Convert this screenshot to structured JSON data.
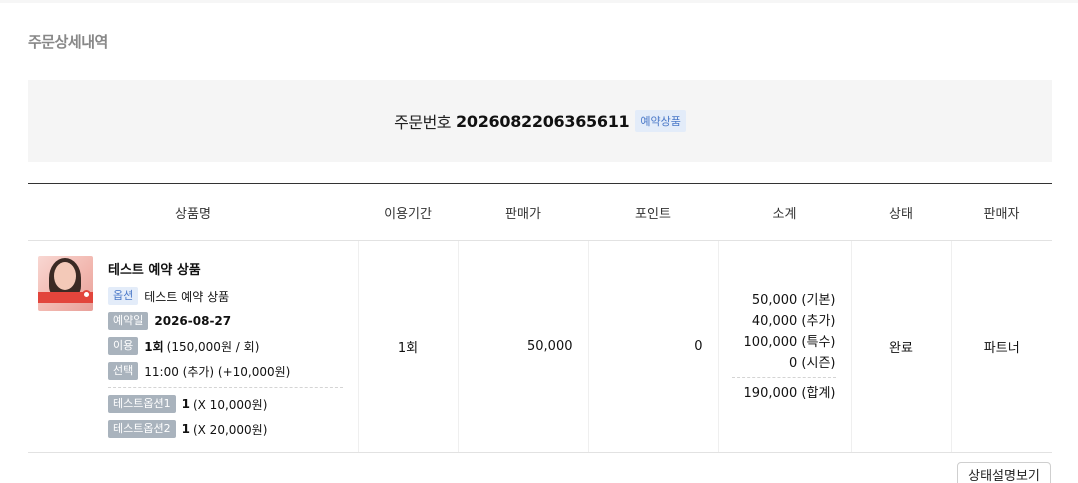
{
  "page": {
    "title": "주문상세내역"
  },
  "order": {
    "label": "주문번호",
    "number": "2026082206365611",
    "badge": "예약상품"
  },
  "table": {
    "headers": [
      "상품명",
      "이용기간",
      "판매가",
      "포인트",
      "소계",
      "상태",
      "판매자"
    ],
    "rows": [
      {
        "product": {
          "name": "테스트 예약 상품",
          "option": {
            "tag": "옵션",
            "text": "테스트 예약 상품"
          },
          "reservation": {
            "tag": "예약일",
            "date": "2026-08-27"
          },
          "use": {
            "tag": "이용",
            "count": "1회",
            "detail": "(150,000원 / 회)"
          },
          "select": {
            "tag": "선택",
            "text": "11:00 (추가) (+10,000원)"
          },
          "extra_options": [
            {
              "tag": "테스트옵션1",
              "qty": "1",
              "detail": "(X 10,000원)"
            },
            {
              "tag": "테스트옵션2",
              "qty": "1",
              "detail": "(X 20,000원)"
            }
          ]
        },
        "period": "1회",
        "price": "50,000",
        "point": "0",
        "subtotal": {
          "lines": [
            "50,000 (기본)",
            "40,000 (추가)",
            "100,000 (특수)",
            "0 (시즌)"
          ],
          "total": "190,000 (합계)"
        },
        "status": "완료",
        "seller": "파트너"
      }
    ]
  },
  "buttons": {
    "status_desc": "상태설명보기"
  }
}
